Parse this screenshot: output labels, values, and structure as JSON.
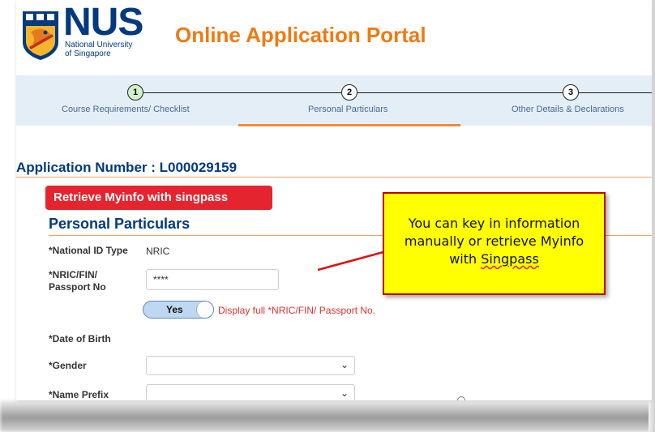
{
  "header": {
    "logo_text": "NUS",
    "logo_subtitle_line1": "National University",
    "logo_subtitle_line2": "of Singapore",
    "title": "Online Application Portal"
  },
  "steps": [
    {
      "number": "1",
      "label": "Course Requirements/ Checklist",
      "status": "completed"
    },
    {
      "number": "2",
      "label": "Personal Particulars",
      "status": "current"
    },
    {
      "number": "3",
      "label": "Other Details & Declarations",
      "status": "upcoming"
    }
  ],
  "application": {
    "number_text": "Application Number : L000029159"
  },
  "myinfo_button": {
    "label": "Retrieve Myinfo with singpass"
  },
  "section": {
    "title": "Personal Particulars"
  },
  "form": {
    "national_id_type_label": "*National ID Type",
    "national_id_type_value": "NRIC",
    "nric_label_line1": "*NRIC/FIN/",
    "nric_label_line2": "Passport No",
    "nric_value": "****",
    "toggle_label": "Yes",
    "display_full_label": "Display full *NRIC/FIN/ Passport No.",
    "dob_label": "*Date of Birth",
    "gender_label": "*Gender",
    "gender_value": "",
    "name_prefix_label": "*Name Prefix",
    "name_prefix_value": ""
  },
  "callout": {
    "line1": "You can key in information",
    "line2": "manually or retrieve Myinfo",
    "line3_prefix": "with ",
    "line3_word": "Singpass"
  },
  "colors": {
    "nus_blue": "#013A7E",
    "nus_orange": "#F07A10",
    "singpass_red": "#E4242E",
    "callout_yellow": "#FFFF00",
    "callout_border": "#C00000",
    "step_bar_bg": "#E3EEF7"
  }
}
